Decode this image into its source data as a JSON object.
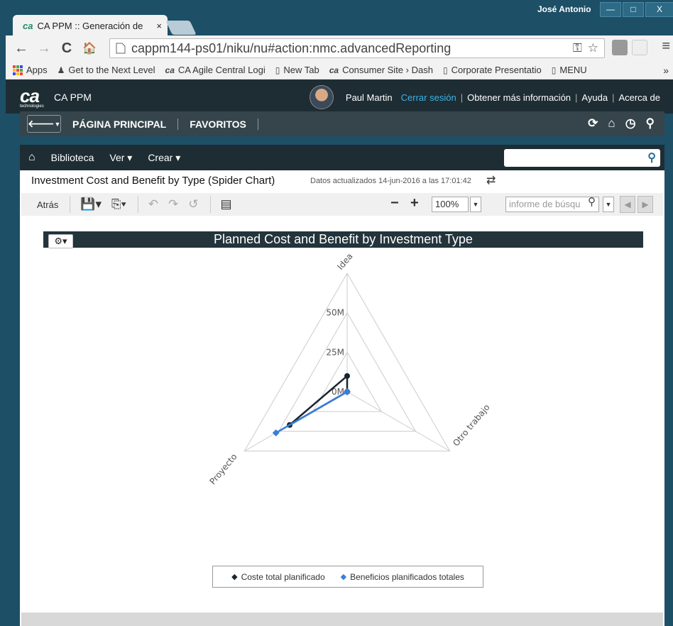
{
  "window": {
    "user": "José Antonio",
    "btn_min": "—",
    "btn_max": "□",
    "btn_close": "X"
  },
  "tab": {
    "logo": "ca",
    "title": "CA PPM :: Generación de",
    "close": "×"
  },
  "toolbar": {
    "back": "←",
    "forward": "→",
    "reload": "C",
    "home": "🏠",
    "url": "cappm144-ps01/niku/nu#action:nmc.advancedReporting",
    "menu": "≡"
  },
  "bookmarks": [
    {
      "label": "Apps"
    },
    {
      "label": "Get to the Next Level"
    },
    {
      "label": "CA Agile Central Logi"
    },
    {
      "label": "New Tab"
    },
    {
      "label": "Consumer Site › Dash"
    },
    {
      "label": "Corporate Presentatio"
    },
    {
      "label": "MENU"
    }
  ],
  "app": {
    "logo": "ca",
    "logo_sub": "technologies",
    "name": "CA PPM",
    "user": "Paul Martin",
    "logout": "Cerrar sesión",
    "more_info": "Obtener más información",
    "help": "Ayuda",
    "about": "Acerca de"
  },
  "nav": {
    "home_label": "PÁGINA PRINCIPAL",
    "favorites_label": "FAVORITOS"
  },
  "subnav": {
    "library": "Biblioteca",
    "view": "Ver ▾",
    "create": "Crear ▾"
  },
  "report": {
    "title": "Investment Cost and Benefit by Type (Spider Chart)",
    "updated": "Datos actualizados 14-jun-2016 a las 17:01:42",
    "back": "Atrás",
    "zoom": "100%",
    "find_placeholder": "informe de búsqu"
  },
  "chart_data": {
    "type": "radar",
    "title": "Planned Cost and Benefit by Investment Type",
    "categories": [
      "Idea",
      "Otro trabajo",
      "Proyecto"
    ],
    "radial_ticks": [
      "0M",
      "25M",
      "50M"
    ],
    "rmax": 75,
    "series": [
      {
        "name": "Coste total planificado",
        "color": "#1a2530",
        "values": [
          10,
          0,
          42
        ]
      },
      {
        "name": "Beneficios planificados totales",
        "color": "#3a7fd5",
        "values": [
          0,
          0,
          52
        ]
      }
    ],
    "legend": "bottom"
  }
}
